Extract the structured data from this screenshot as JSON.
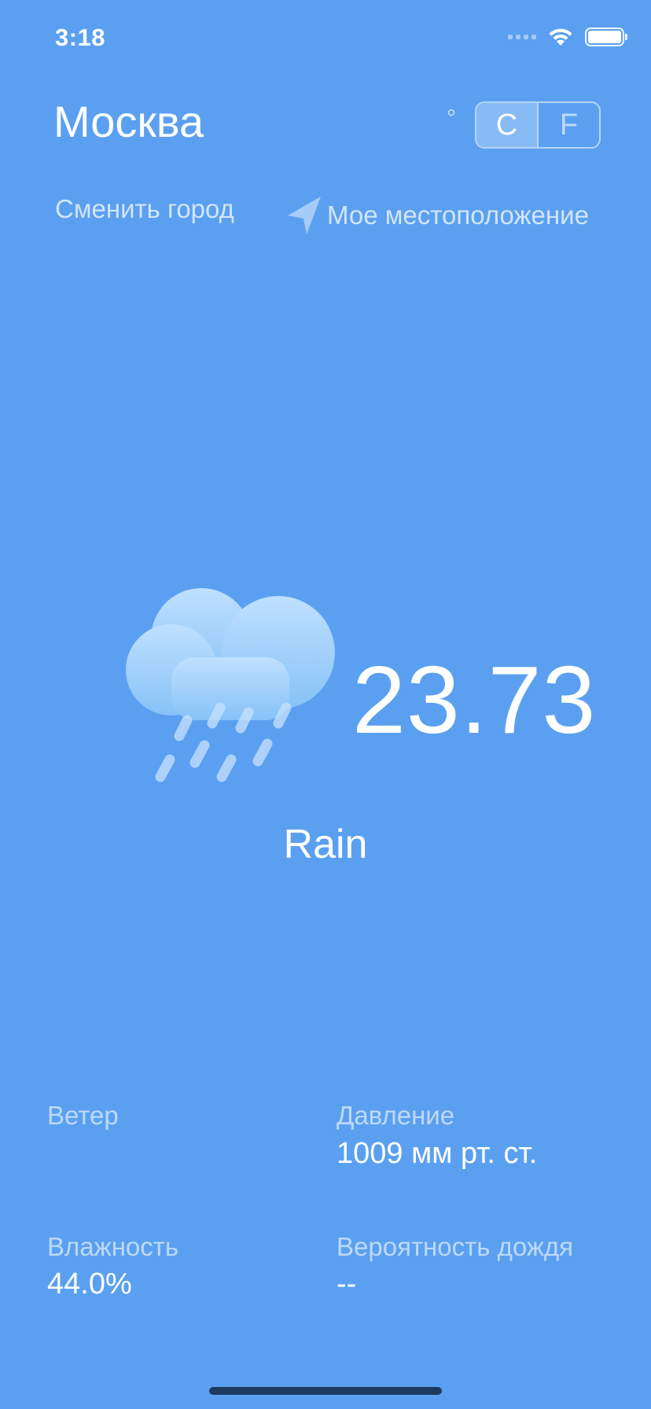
{
  "status_bar": {
    "time": "3:18",
    "icons": [
      "signal-icon",
      "wifi-icon",
      "battery-icon"
    ]
  },
  "header": {
    "city": "Москва",
    "degree_symbol": "°",
    "unit_celsius": "C",
    "unit_fahrenheit": "F",
    "selected_unit": "C",
    "change_city": "Сменить город",
    "my_location": "Мое местоположение",
    "location_icon": "location-arrow-icon"
  },
  "weather": {
    "icon": "rain-cloud-icon",
    "temperature": "23.73",
    "condition": "Rain"
  },
  "details": {
    "wind": {
      "label": "Ветер",
      "value": ""
    },
    "pressure": {
      "label": "Давление",
      "value": "1009 мм рт. ст."
    },
    "humidity": {
      "label": "Влажность",
      "value": "44.0%"
    },
    "rain_chance": {
      "label": "Вероятность дождя",
      "value": "--"
    }
  },
  "colors": {
    "background": "#5ba0f0",
    "text": "#ffffff"
  }
}
